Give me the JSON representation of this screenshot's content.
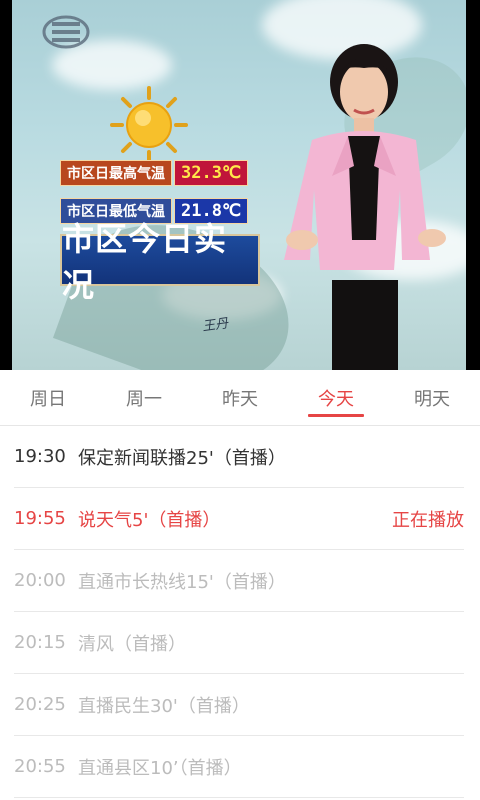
{
  "video": {
    "overlay": {
      "max_label": "市区日最高气温",
      "max_value": "32.3℃",
      "min_label": "市区日最低气温",
      "min_value": "21.8℃",
      "title": "市区今日实况",
      "signature": "王丹"
    }
  },
  "tabs": [
    {
      "label": "周日"
    },
    {
      "label": "周一"
    },
    {
      "label": "昨天"
    },
    {
      "label": "今天"
    },
    {
      "label": "明天"
    }
  ],
  "schedule": [
    {
      "time": "19:30",
      "title": "保定新闻联播25'（首播）",
      "status": ""
    },
    {
      "time": "19:55",
      "title": "说天气5'（首播）",
      "status": "正在播放"
    },
    {
      "time": "20:00",
      "title": "直通市长热线15'（首播）",
      "status": ""
    },
    {
      "time": "20:15",
      "title": "清风（首播）",
      "status": ""
    },
    {
      "time": "20:25",
      "title": "直播民生30'（首播）",
      "status": ""
    },
    {
      "time": "20:55",
      "title": "直通县区10’（首播）",
      "status": ""
    }
  ],
  "colors": {
    "accent": "#e64545",
    "past_text": "#333333",
    "upcoming_text": "#bcbcbc"
  }
}
